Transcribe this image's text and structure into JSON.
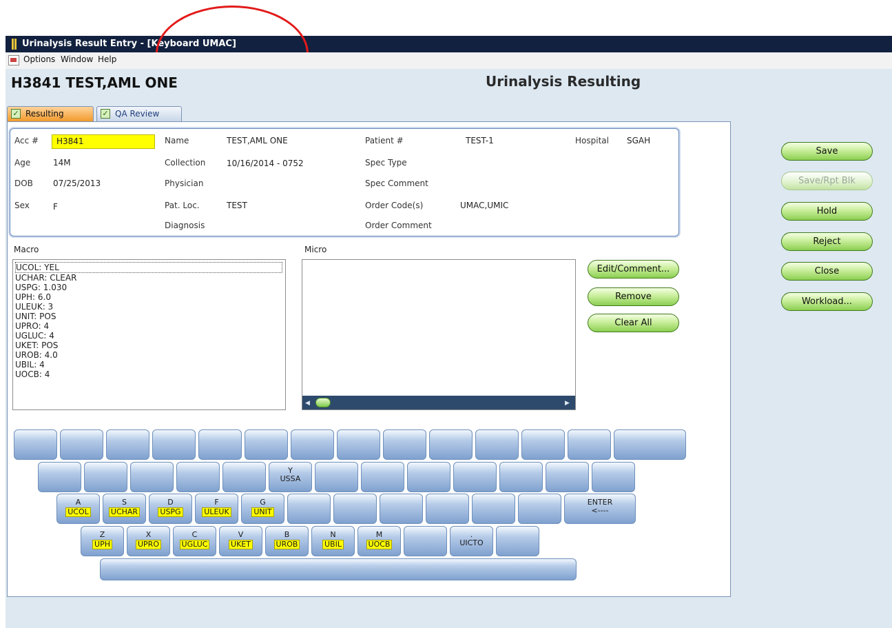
{
  "window": {
    "title": "Urinalysis Result Entry - [Keyboard UMAC]"
  },
  "menu": [
    "Options",
    "Window",
    "Help"
  ],
  "header": {
    "patient": "H3841 TEST,AML ONE",
    "screen_title": "Urinalysis Resulting"
  },
  "tabs": [
    {
      "label": "Resulting",
      "active": true
    },
    {
      "label": "QA Review",
      "active": false
    }
  ],
  "info": {
    "acc_label": "Acc #",
    "acc_value": "H3841",
    "age_label": "Age",
    "age_value": "14M",
    "dob_label": "DOB",
    "dob_value": "07/25/2013",
    "sex_label": "Sex",
    "sex_value": "F",
    "name_label": "Name",
    "name_value": "TEST,AML ONE",
    "collection_label": "Collection",
    "collection_value": "10/16/2014 - 0752",
    "physician_label": "Physician",
    "physician_value": "",
    "patloc_label": "Pat. Loc.",
    "patloc_value": "TEST",
    "diagnosis_label": "Diagnosis",
    "diagnosis_value": "",
    "patientnum_label": "Patient #",
    "patientnum_value": "TEST-1",
    "spectype_label": "Spec Type",
    "spectype_value": "",
    "speccomment_label": "Spec Comment",
    "speccomment_value": "",
    "ordercode_label": "Order Code(s)",
    "ordercode_value": "UMAC,UMIC",
    "ordercomment_label": "Order Comment",
    "ordercomment_value": "",
    "hospital_label": "Hospital",
    "hospital_value": "SGAH"
  },
  "macro": {
    "label": "Macro",
    "lines": [
      "UCOL: YEL",
      "UCHAR: CLEAR",
      "USPG: 1.030",
      "UPH: 6.0",
      "ULEUK: 3",
      "UNIT: POS",
      "UPRO: 4",
      "UGLUC: 4",
      "UKET: POS",
      "UROB: 4.0",
      "UBIL: 4",
      "UOCB: 4"
    ]
  },
  "micro": {
    "label": "Micro",
    "scroll_position": 0
  },
  "micro_buttons": {
    "edit": "Edit/Comment...",
    "remove": "Remove",
    "clear": "Clear All"
  },
  "side_buttons": {
    "save": "Save",
    "save_rpt": "Save/Rpt Blk",
    "hold": "Hold",
    "reject": "Reject",
    "close": "Close",
    "workload": "Workload..."
  },
  "keyboard": {
    "row2": {
      "y_label": "Y",
      "y_code": "USSA"
    },
    "row3": [
      {
        "letter": "A",
        "code": "UCOL"
      },
      {
        "letter": "S",
        "code": "UCHAR"
      },
      {
        "letter": "D",
        "code": "USPG"
      },
      {
        "letter": "F",
        "code": "ULEUK"
      },
      {
        "letter": "G",
        "code": "UNIT"
      }
    ],
    "enter_label": "ENTER",
    "enter_arrow": "<----",
    "row4": [
      {
        "letter": "Z",
        "code": "UPH"
      },
      {
        "letter": "X",
        "code": "UPRO"
      },
      {
        "letter": "C",
        "code": "UGLUC"
      },
      {
        "letter": "V",
        "code": "UKET"
      },
      {
        "letter": "B",
        "code": "UROB"
      },
      {
        "letter": "N",
        "code": "UBIL"
      },
      {
        "letter": "M",
        "code": "UOCB"
      }
    ],
    "period_label": ".",
    "period_code": "UICTO"
  },
  "colors": {
    "titlebar": "#12213f",
    "accent_green": "#8ccf52",
    "highlight_yellow": "#ffff00",
    "annotation_red": "#e21a1a"
  }
}
